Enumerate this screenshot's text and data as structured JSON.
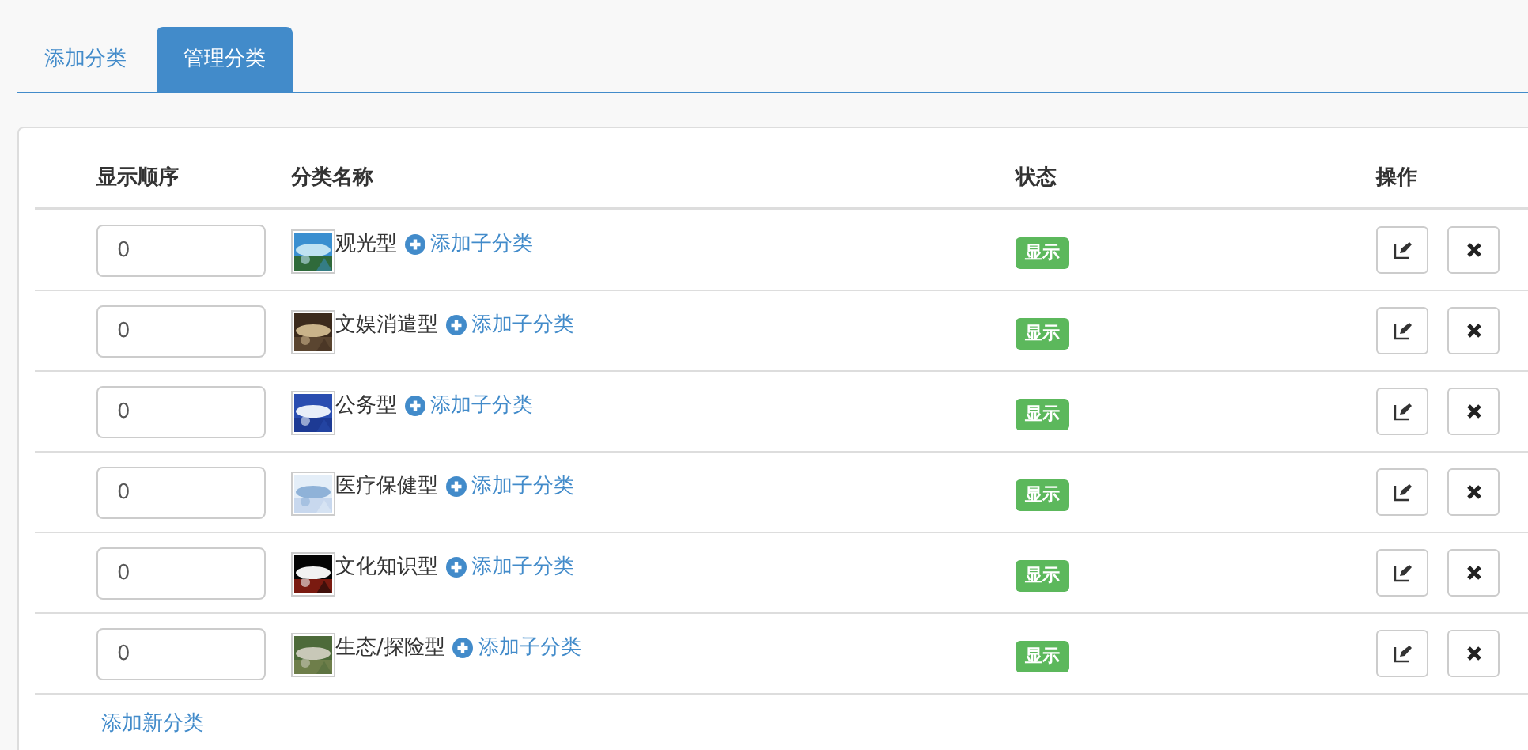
{
  "tabs": [
    {
      "label": "添加分类",
      "selected": false
    },
    {
      "label": "管理分类",
      "selected": true
    }
  ],
  "table": {
    "columns": [
      "显示顺序",
      "分类名称",
      "状态",
      "操作"
    ],
    "rows": [
      {
        "order": "0",
        "name": "观光型",
        "add_child": "添加子分类",
        "status": {
          "label": "显示",
          "kind": "success"
        }
      },
      {
        "order": "0",
        "name": "文娱消遣型",
        "add_child": "添加子分类",
        "status": {
          "label": "显示",
          "kind": "success"
        }
      },
      {
        "order": "0",
        "name": "公务型",
        "add_child": "添加子分类",
        "status": {
          "label": "显示",
          "kind": "success"
        }
      },
      {
        "order": "0",
        "name": "医疗保健型",
        "add_child": "添加子分类",
        "status": {
          "label": "显示",
          "kind": "success"
        }
      },
      {
        "order": "0",
        "name": "文化知识型",
        "add_child": "添加子分类",
        "status": {
          "label": "显示",
          "kind": "success"
        }
      },
      {
        "order": "0",
        "name": "生态/探险型",
        "add_child": "添加子分类",
        "status": {
          "label": "显示",
          "kind": "success"
        }
      }
    ]
  },
  "add_link": "添加新分类"
}
